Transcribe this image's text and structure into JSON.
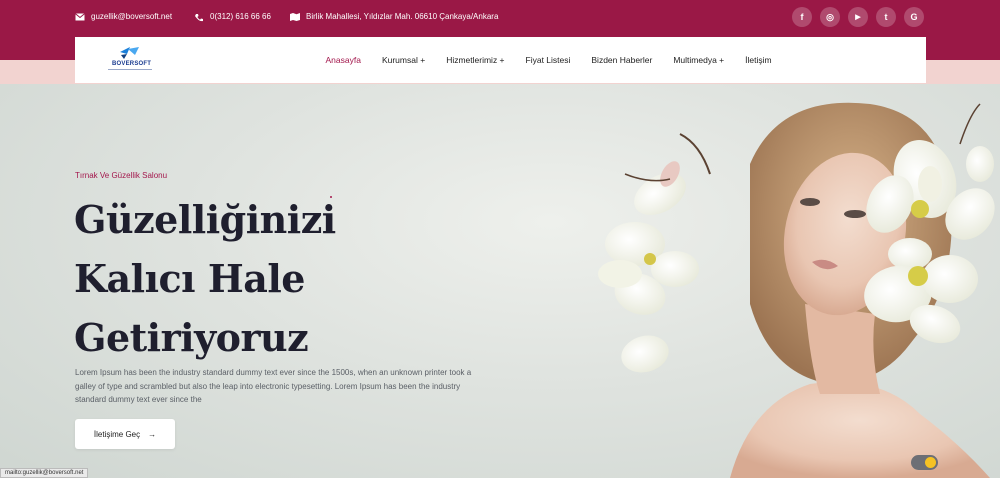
{
  "topbar": {
    "email": "guzellik@boversoft.net",
    "phone": "0(312) 616 66 66",
    "address": "Birlik Mahallesi, Yıldızlar Mah. 06610 Çankaya/Ankara",
    "socials": [
      {
        "icon": "facebook-icon",
        "glyph": "f"
      },
      {
        "icon": "instagram-icon",
        "glyph": "◎"
      },
      {
        "icon": "youtube-icon",
        "glyph": "▶"
      },
      {
        "icon": "twitter-icon",
        "glyph": "t"
      },
      {
        "icon": "google-icon",
        "glyph": "G"
      }
    ]
  },
  "brand": {
    "name": "BOVERSOFT"
  },
  "nav": {
    "items": [
      {
        "label": "Anasayfa",
        "active": true
      },
      {
        "label": "Kurumsal +"
      },
      {
        "label": "Hizmetlerimiz +"
      },
      {
        "label": "Fiyat Listesi"
      },
      {
        "label": "Bizden Haberler"
      },
      {
        "label": "Multimedya +"
      },
      {
        "label": "İletişim"
      }
    ]
  },
  "hero": {
    "subtitle": "Tırnak Ve Güzellik Salonu",
    "title_lines": [
      "Güzelliğinizi",
      "Kalıcı Hale",
      "Getiriyoruz"
    ],
    "text": "Lorem Ipsum has been the industry standard dummy text ever since the 1500s, when an unknown printer took a galley of type and scrambled but also the leap into electronic typesetting. Lorem Ipsum has been the industry standard dummy text ever since the",
    "cta_label": "İletişime Geç",
    "cta_arrow": "→"
  },
  "status": {
    "url": "mailto:guzellik@boversoft.net"
  },
  "colors": {
    "primary": "#9a1846",
    "accent": "#a3174c",
    "band": "#f2d3d0"
  }
}
